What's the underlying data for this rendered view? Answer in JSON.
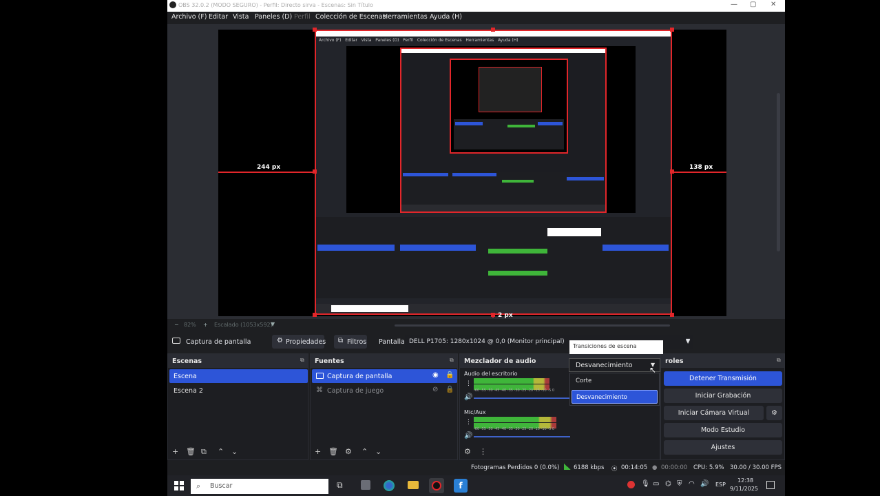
{
  "window": {
    "title": "OBS 32.0.2 (MODO SEGURO) - Perfil: Directo sirva - Escenas: Sin Título",
    "minimize": "—",
    "maximize": "▢",
    "close": "✕"
  },
  "menu": [
    "Archivo (F)",
    "Editar",
    "Vista",
    "Paneles (D)",
    "Perfil",
    "Colección de Escenas",
    "Herramientas",
    "Ayuda (H)"
  ],
  "preview": {
    "left_label": "244 px",
    "right_label": "138 px",
    "bottom_label": "2 px",
    "zoom": "82%",
    "scale_label": "Escalado (1053x592)"
  },
  "source_bar": {
    "source_name": "Captura de pantalla",
    "properties": "Propiedades",
    "filters": "Filtros",
    "screen_label": "Pantalla",
    "screen_value": "DELL P1705: 1280x1024 @ 0,0 (Monitor principal)"
  },
  "scenes": {
    "header": "Escenas",
    "items": [
      "Escena",
      "Escena 2"
    ]
  },
  "sources": {
    "header": "Fuentes",
    "items": [
      "Captura de pantalla",
      "Captura de juego"
    ]
  },
  "mixer": {
    "header": "Mezclador de audio",
    "channels": [
      {
        "name": "Audio del escritorio",
        "ticks": "-60 -55 -50 -45 -40 -35 -30 -25 -20 -15 -10 -5 0"
      },
      {
        "name": "Mic/Aux",
        "ticks": "-60 -55 -50 -45 -40 -35 -30 -25 -20 -15 -10 -5 0"
      }
    ]
  },
  "transitions": {
    "tooltip": "Transiciones de escena",
    "selected": "Desvanecimiento",
    "options": [
      "Corte",
      "Desvanecimiento"
    ]
  },
  "controls": {
    "header": "roles",
    "stop_stream": "Detener Transmisión",
    "start_recording": "Iniciar Grabación",
    "virtual_camera": "Iniciar Cámara Virtual",
    "studio_mode": "Modo Estudio",
    "settings": "Ajustes"
  },
  "status": {
    "dropped_frames": "Fotogramas Perdidos 0 (0.0%)",
    "bitrate": "6188 kbps",
    "stream_time": "00:14:05",
    "rec_time": "00:00:00",
    "cpu": "CPU: 5.9%",
    "fps": "30.00 / 30.00 FPS"
  },
  "taskbar": {
    "search_placeholder": "Buscar",
    "lang": "ESP",
    "time": "12:38",
    "date": "9/11/2025"
  },
  "colors": {
    "accent": "#2d55d8",
    "selection_red": "#e2262a",
    "meter_green": "#3fb53a"
  }
}
